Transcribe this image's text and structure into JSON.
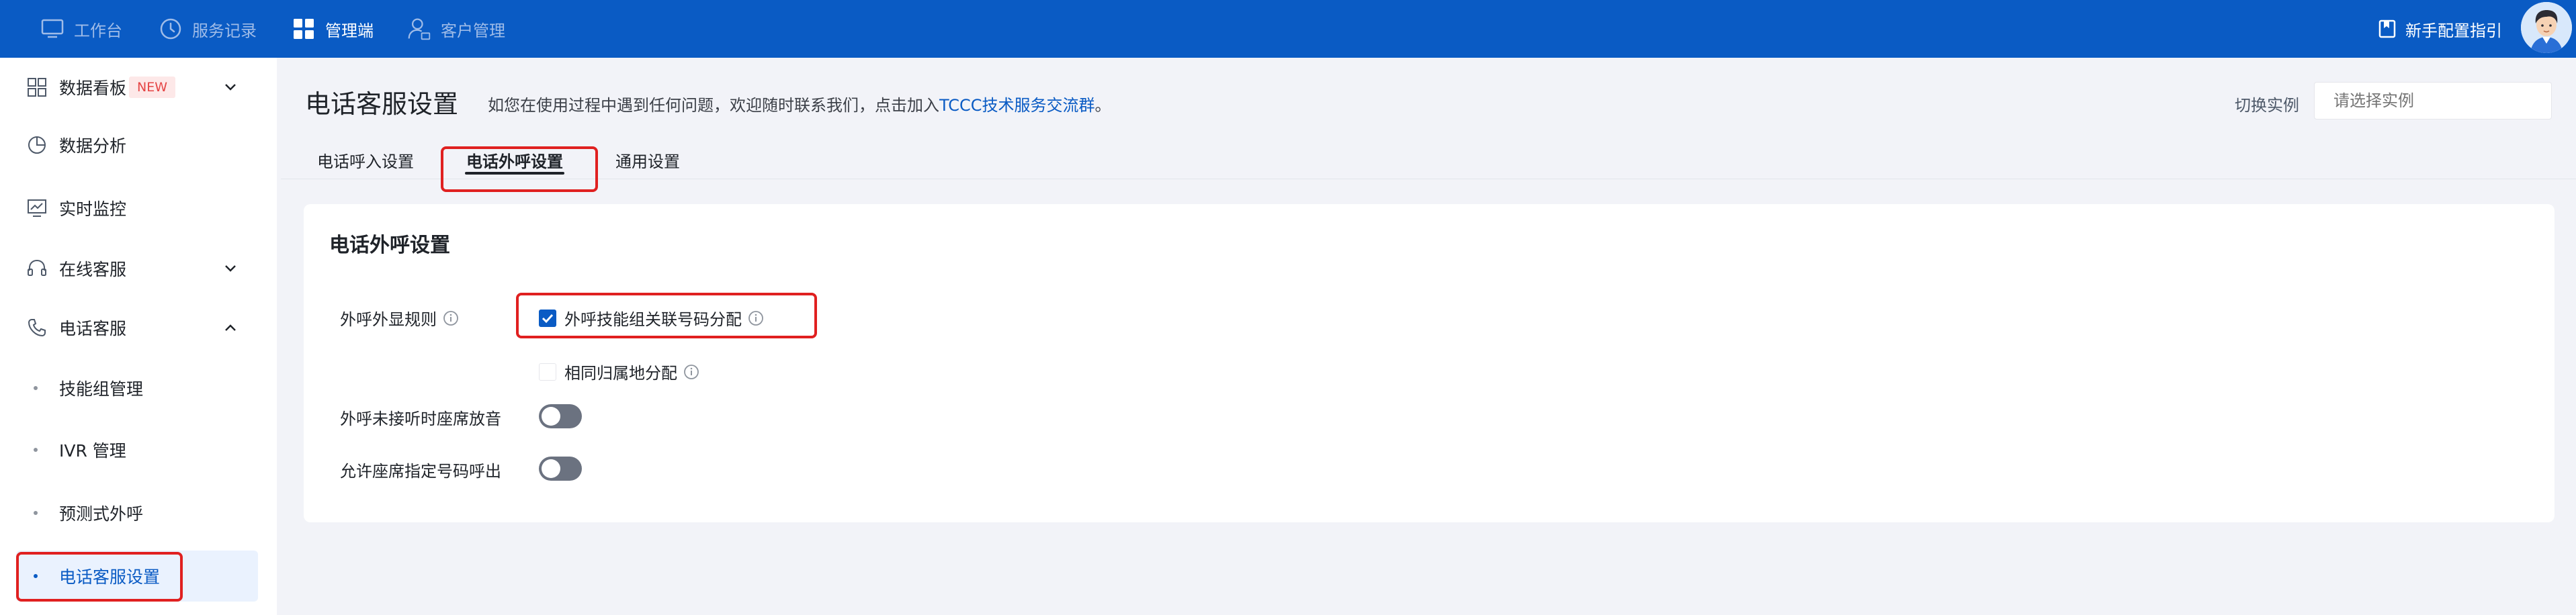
{
  "topbar": {
    "nav": [
      {
        "label": "工作台",
        "icon": "monitor-icon"
      },
      {
        "label": "服务记录",
        "icon": "clock-icon"
      },
      {
        "label": "管理端",
        "icon": "grid-icon",
        "active": true
      },
      {
        "label": "客户管理",
        "icon": "user-icon"
      }
    ],
    "guide_label": "新手配置指引",
    "guide_icon": "book-icon",
    "avatar": "avatar"
  },
  "sidebar": {
    "items": [
      {
        "label": "数据看板",
        "icon": "dashboard-icon",
        "badge": "NEW",
        "chevron": "chevron-down-icon"
      },
      {
        "label": "数据分析",
        "icon": "pie-chart-icon"
      },
      {
        "label": "实时监控",
        "icon": "monitor-chart-icon"
      },
      {
        "label": "在线客服",
        "icon": "headset-icon",
        "chevron": "chevron-down-icon"
      },
      {
        "label": "电话客服",
        "icon": "phone-icon",
        "chevron": "chevron-up-icon"
      }
    ],
    "subitems": [
      {
        "label": "技能组管理"
      },
      {
        "label": "IVR 管理"
      },
      {
        "label": "预测式外呼"
      },
      {
        "label": "电话客服设置",
        "active": true
      }
    ]
  },
  "header": {
    "title": "电话客服设置",
    "desc_prefix": "如您在使用过程中遇到任何问题，欢迎随时联系我们，点击加入",
    "desc_link": "TCCC技术服务交流群",
    "desc_suffix": "。",
    "switch_label": "切换实例",
    "instance_placeholder": "请选择实例"
  },
  "tabs": [
    {
      "label": "电话呼入设置"
    },
    {
      "label": "电话外呼设置",
      "active": true
    },
    {
      "label": "通用设置"
    }
  ],
  "card": {
    "title": "电话外呼设置",
    "rule_label": "外呼外显规则",
    "options": [
      {
        "label": "外呼技能组关联号码分配",
        "checked": true
      },
      {
        "label": "相同归属地分配",
        "checked": false
      }
    ],
    "toggles": [
      {
        "label": "外呼未接听时座席放音",
        "on": false
      },
      {
        "label": "允许座席指定号码呼出",
        "on": false
      }
    ]
  },
  "colors": {
    "topbar": "#0a5bc4",
    "accent": "#0a5bc4",
    "highlight": "#e02020",
    "badge_bg": "#fde8e8",
    "badge_text": "#e54545"
  }
}
